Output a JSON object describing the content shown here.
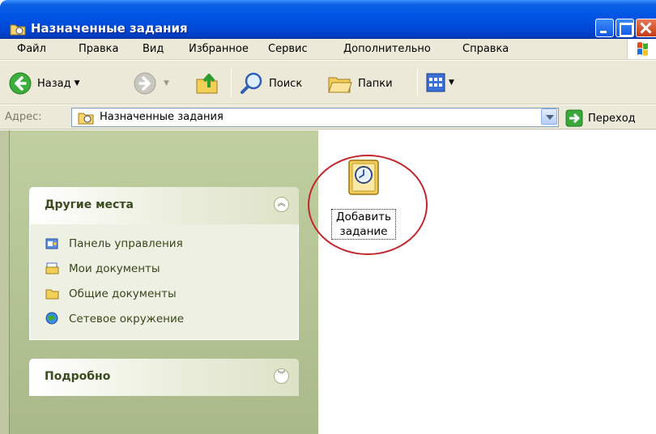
{
  "window": {
    "title": "Назначенные задания"
  },
  "menu": {
    "items": [
      "Файл",
      "Правка",
      "Вид",
      "Избранное",
      "Сервис",
      "Дополнительно",
      "Справка"
    ]
  },
  "toolbar": {
    "back_label": "Назад",
    "search_label": "Поиск",
    "folders_label": "Папки"
  },
  "address": {
    "label": "Адрес:",
    "value": "Назначенные задания",
    "go_label": "Переход"
  },
  "task_pane": {
    "other_places": {
      "title": "Другие места",
      "links": [
        "Панель управления",
        "Мои документы",
        "Общие документы",
        "Сетевое окружение"
      ]
    },
    "details": {
      "title": "Подробно"
    }
  },
  "content": {
    "item_label_line1": "Добавить",
    "item_label_line2": "задание"
  },
  "colors": {
    "titlebar": "#0054e3",
    "highlight_circle": "#c1272d",
    "task_pane_bg": "#c0cfa0"
  }
}
